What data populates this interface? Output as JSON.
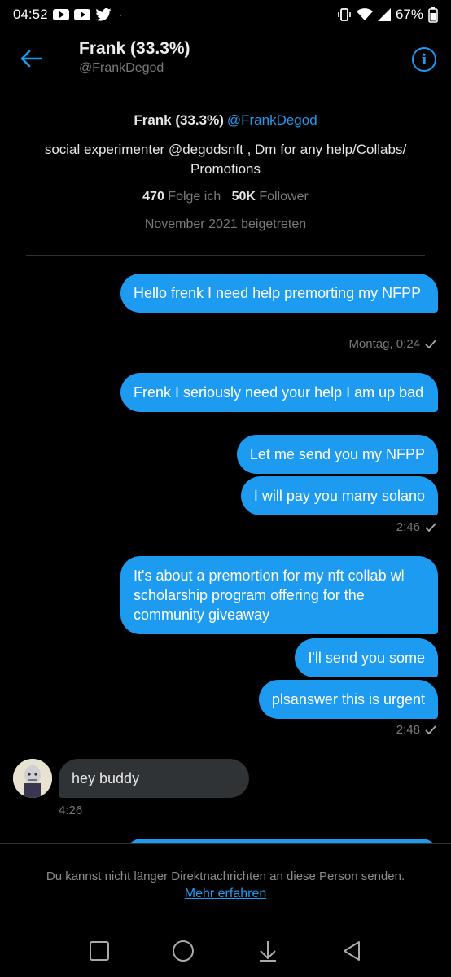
{
  "status_bar": {
    "time": "04:52",
    "battery": "67%",
    "notification_icons": [
      "youtube-icon",
      "youtube-icon",
      "twitter-icon"
    ],
    "system_icons": [
      "vibrate-icon",
      "wifi-icon",
      "signal-icon",
      "battery-icon"
    ]
  },
  "header": {
    "title": "Frank (33.3%)",
    "handle": "@FrankDegod"
  },
  "profile": {
    "name": "Frank (33.3%)",
    "handle": "@FrankDegod",
    "bio": "social experimenter @degodsnft , Dm for any help/Collabs/ Promotions",
    "following_count": "470",
    "following_label": "Folge ich",
    "followers_count": "50K",
    "followers_label": "Follower",
    "joined": "November 2021 beigetreten"
  },
  "messages": [
    {
      "text": "Hello frenk I need help premorting my NFPP",
      "direction": "out"
    },
    {
      "meta": "Montag, 0:24"
    },
    {
      "text": "Frenk I seriously need your help I am up bad",
      "direction": "out"
    },
    {
      "text": "Let me send you my NFPP",
      "direction": "out"
    },
    {
      "text": "I will pay you many solano",
      "direction": "out"
    },
    {
      "meta": "2:46"
    },
    {
      "text": "It's about a premortion for my nft collab wl scholarship program offering for the community giveaway",
      "direction": "out"
    },
    {
      "text": "I'll send you some",
      "direction": "out"
    },
    {
      "text": "plsanswer this is urgent",
      "direction": "out"
    },
    {
      "meta": "2:48"
    },
    {
      "text": "hey buddy",
      "direction": "in"
    },
    {
      "meta": "4:26"
    }
  ],
  "notice": {
    "text": "Du kannst nicht länger Direktnachrichten an diese Person senden.",
    "link": "Mehr erfahren"
  },
  "colors": {
    "accent": "#1d9bf0",
    "background": "#000000",
    "incoming_bubble": "#2f3336"
  }
}
